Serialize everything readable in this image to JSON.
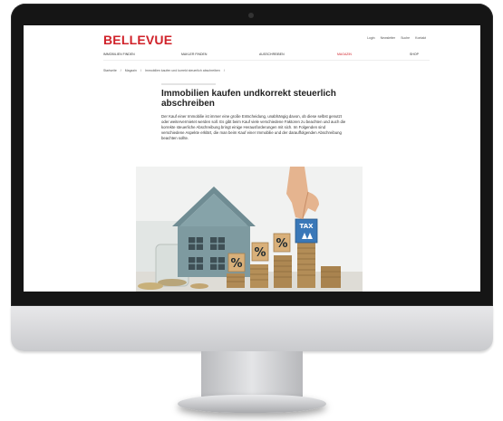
{
  "site": {
    "brand": "BELLEVUE",
    "top_links": [
      "Login",
      "Newsletter",
      "Suche",
      "Kontakt"
    ],
    "nav": [
      {
        "label": "IMMOBILIEN FINDEN",
        "active": false
      },
      {
        "label": "MAKLER FINDEN",
        "active": false
      },
      {
        "label": "AUSSCHREIBEN",
        "active": false
      },
      {
        "label": "MAGAZIN",
        "active": true
      },
      {
        "label": "SHOP",
        "active": false
      }
    ],
    "accent_color": "#d0222a"
  },
  "breadcrumb": [
    "Startseite",
    "/",
    "Magazin",
    "/",
    "Immobilien kaufen und korrekt steuerlich abschreiben",
    "/"
  ],
  "article": {
    "headline": "Immobilien kaufen undkorrekt steuerlich abschreiben",
    "lead": "Der Kauf einer Immobilie ist immer eine große Entscheidung, unabhängig davon, ob diese selbst genutzt oder weitervermietet werden soll. Es gibt beim Kauf viele verschiedene Faktoren zu beachten und auch die korrekte steuerliche Abschreibung bringt einige Herausforderungen mit sich. Im Folgenden sind verschiedene Aspekte erklärt, die man beim Kauf einer Immobilie und der darauffolgenden Abschreibung beachten sollte.",
    "hero_alt_icons": [
      "house-model-icon",
      "percent-block-icon",
      "tax-block-icon",
      "coin-stack-icon",
      "hand-icon"
    ],
    "hero_tax_label": "TAX",
    "hero_percent": "%"
  }
}
